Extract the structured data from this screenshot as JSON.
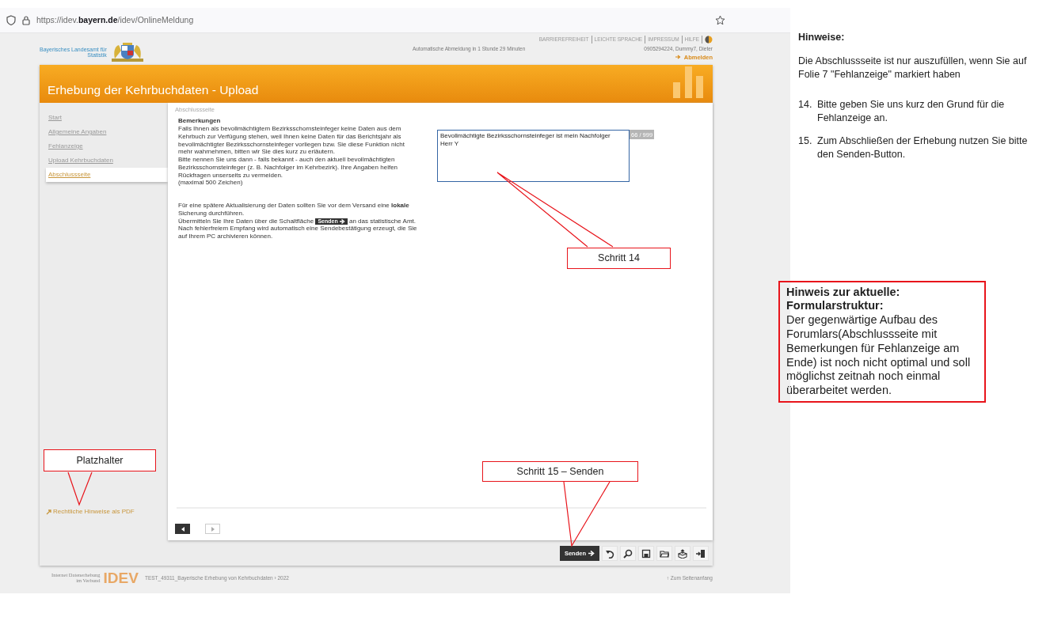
{
  "browser": {
    "url": "https://idev.**bayern.de**/idev/OnlineMeldung"
  },
  "site_header": {
    "logo_lines": [
      "Bayerisches Landesamt für",
      "Statistik"
    ],
    "top_links": [
      "BARRIEREFREIHEIT",
      "LEICHTE SPRACHE",
      "IMPRESSUM",
      "HILFE"
    ],
    "session_notice": "Automatische Abmeldung in 1 Stunde 29 Minuten",
    "user": "0905294224, Dummy7, Dieter",
    "logout": "Abmelden"
  },
  "page_title": "Erhebung der Kehrbuchdaten - Upload",
  "sidebar": {
    "items": [
      {
        "label": "Start",
        "selected": false
      },
      {
        "label": "Allgemeine Angaben",
        "selected": false
      },
      {
        "label": "Fehlanzeige",
        "selected": false
      },
      {
        "label": "Upload Kehrbuchdaten",
        "selected": false
      },
      {
        "label": "Abschlussseite",
        "selected": true
      }
    ],
    "legal_link": "Rechtliche Hinweise als PDF"
  },
  "content": {
    "breadcrumb": "Abschlussseite",
    "remarks_heading": "Bemerkungen",
    "remarks_paragraphs": [
      "Falls Ihnen als bevollmächtigtem Bezirksschornsteinfeger keine Daten aus dem Kehrbuch zur Verfügung stehen, weil Ihnen keine Daten für das Berichtsjahr als bevollmächtigter Bezirksschornsteinfeger vorliegen bzw. Sie diese Funktion nicht mehr wahrnehmen, bitten wir Sie dies kurz zu erläutern.",
      "Bitte nennen Sie uns dann - falls bekannt - auch den aktuell bevollmächtigten Bezirksschornsteinfeger (z. B. Nachfolger im Kehrbezirk). Ihre Angaben helfen Rückfragen unserseits zu vermeiden.",
      "(maximal 500 Zeichen)"
    ],
    "info_paragraphs": [
      {
        "kind": "text",
        "text": "Für eine spätere Aktualisierung der Daten sollten Sie vor dem Versand eine **lokale** Sicherung durchführen."
      },
      {
        "kind": "with_button",
        "before": "Übermitteln Sie Ihre Daten über die Schaltfläche",
        "button": "Senden",
        "after": "an das statistische Amt."
      },
      {
        "kind": "text",
        "text": "Nach fehlerfreiem Empfang wird automatisch eine Sendebestätigung erzeugt, die Sie auf Ihrem PC archivieren können."
      }
    ],
    "remarks_value": "Bevollmächtigte Bezirksschornsteinfeger ist mein Nachfolger\nHerr Y",
    "char_counter": "66 / 999",
    "pager": [
      {
        "kind": "prev",
        "disabled": false
      },
      {
        "kind": "next",
        "disabled": true
      }
    ]
  },
  "toolbar": {
    "send_button": "Senden"
  },
  "footer": {
    "logo_lines": [
      "Internet Datenerhebung",
      "im Verbund"
    ],
    "logo_word": "IDEV",
    "survey": "TEST_49311_Bayerische Erhebung von Kehrbuchdaten › 2022",
    "to_top": "↑ Zum Seitenanfang"
  },
  "callouts": [
    {
      "kind": "placeholder",
      "text": "Platzhalter"
    },
    {
      "kind": "step14",
      "text": "Schritt 14"
    },
    {
      "kind": "step15",
      "text": "Schritt 15 – Senden"
    }
  ],
  "notes": {
    "heading": "Hinweise:",
    "intro": "Die Abschlussseite ist nur auszufüllen, wenn Sie auf Folie 7 \"Fehlanzeige\" markiert haben",
    "steps": [
      {
        "number": "14.",
        "text": "Bitte geben Sie uns kurz den Grund für die Fehlanzeige an."
      },
      {
        "number": "15.",
        "text": "Zum Abschließen der Erhebung nutzen Sie bitte den Senden-Button."
      }
    ],
    "warning_title": "Hinweis zur aktuelle: Formularstruktur:",
    "warning_text": "Der gegenwärtige Aufbau des Forumlars(Abschlussseite mit Bemerkungen für Fehlanzeige am Ende) ist noch nicht optimal und soll möglichst zeitnah noch einmal überarbeitet werden."
  }
}
